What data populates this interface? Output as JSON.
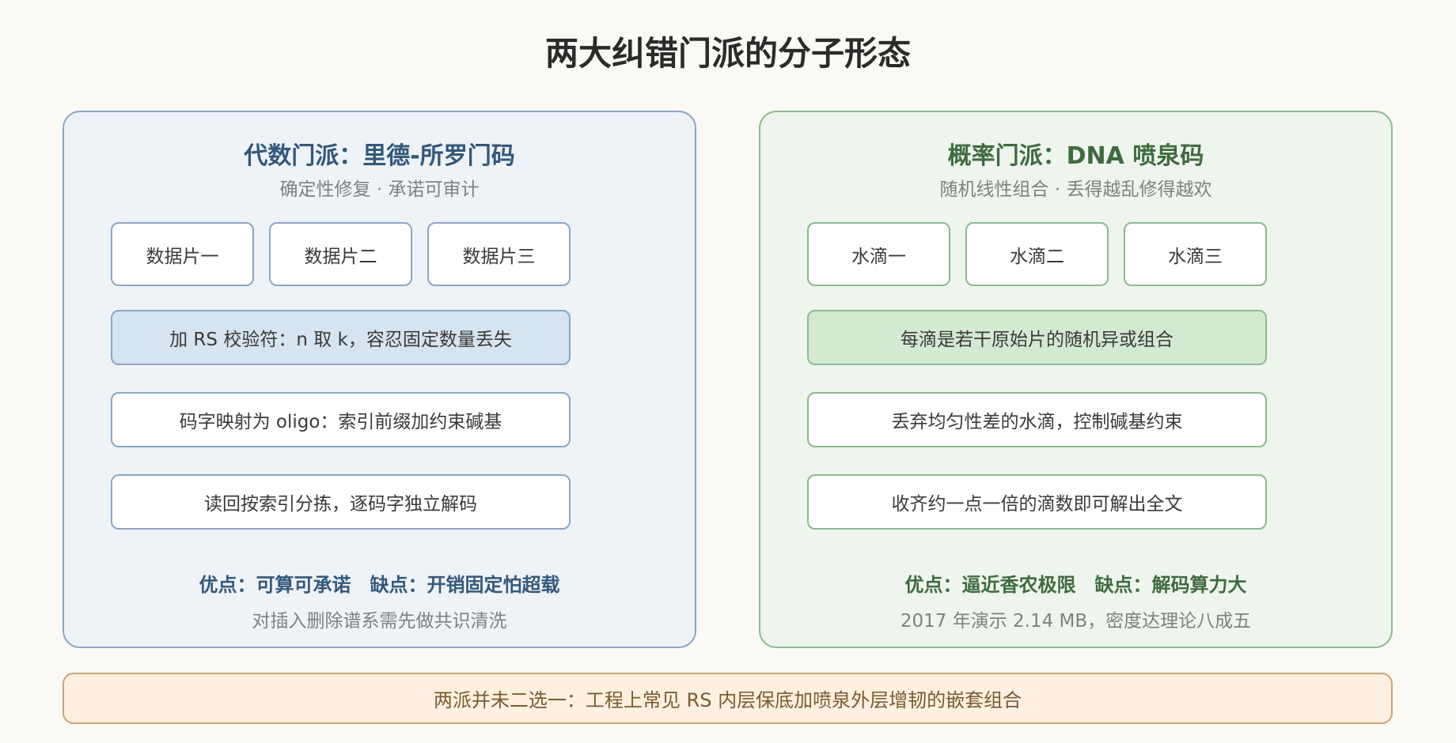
{
  "title": "两大纠错门派的分子形态",
  "left_panel": {
    "title": "代数门派：里德-所罗门码",
    "subtitle": "确定性修复 · 承诺可审计",
    "chips": [
      "数据片一",
      "数据片二",
      "数据片三"
    ],
    "steps": [
      "加 RS 校验符：n 取 k，容忍固定数量丢失",
      "码字映射为 oligo：索引前缀加约束碱基",
      "读回按索引分拣，逐码字独立解码"
    ],
    "pros": "优点：可算可承诺",
    "cons": "缺点：开销固定怕超载",
    "note": "对插入删除谱系需先做共识清洗"
  },
  "right_panel": {
    "title": "概率门派：DNA 喷泉码",
    "subtitle": "随机线性组合 · 丢得越乱修得越欢",
    "chips": [
      "水滴一",
      "水滴二",
      "水滴三"
    ],
    "steps": [
      "每滴是若干原始片的随机异或组合",
      "丢弃均匀性差的水滴，控制碱基约束",
      "收齐约一点一倍的滴数即可解出全文"
    ],
    "pros": "优点：逼近香农极限",
    "cons": "缺点：解码算力大",
    "note": "2017 年演示 2.14 MB，密度达理论八成五"
  },
  "footer": "两派并未二选一：工程上常见 RS 内层保底加喷泉外层增韧的嵌套组合",
  "colors": {
    "left_accent": "#34587b",
    "right_accent": "#3f6b3f",
    "footer_accent": "#c9a577"
  }
}
